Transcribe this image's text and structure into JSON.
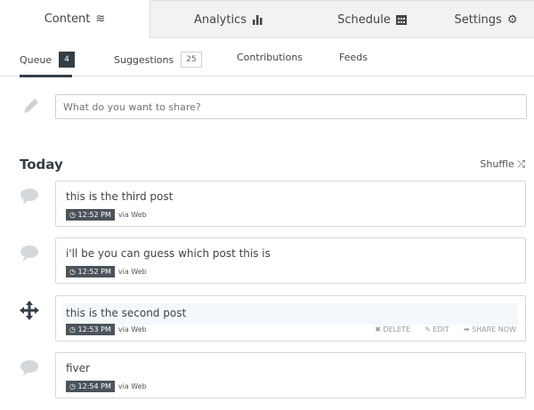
{
  "tabs": [
    {
      "label": "Content",
      "icon": "layers-icon"
    },
    {
      "label": "Analytics",
      "icon": "bar-chart-icon"
    },
    {
      "label": "Schedule",
      "icon": "calendar-icon"
    },
    {
      "label": "Settings",
      "icon": "gear-icon"
    }
  ],
  "subtabs": [
    {
      "label": "Queue",
      "count": "4"
    },
    {
      "label": "Suggestions",
      "count": "25"
    },
    {
      "label": "Contributions"
    },
    {
      "label": "Feeds"
    }
  ],
  "composer": {
    "placeholder": "What do you want to share?"
  },
  "section": {
    "title": "Today",
    "shuffle": "Shuffle"
  },
  "posts": [
    {
      "text": "this is the third post",
      "time": "12:52 PM",
      "via": "via Web"
    },
    {
      "text": "i'll be you can guess which post this is",
      "time": "12:52 PM",
      "via": "via Web"
    },
    {
      "text": "this is the second post",
      "time": "12:53 PM",
      "via": "via Web"
    },
    {
      "text": "fiver",
      "time": "12:54 PM",
      "via": "via Web"
    }
  ],
  "actions": {
    "delete": "DELETE",
    "edit": "EDIT",
    "share": "SHARE NOW"
  }
}
